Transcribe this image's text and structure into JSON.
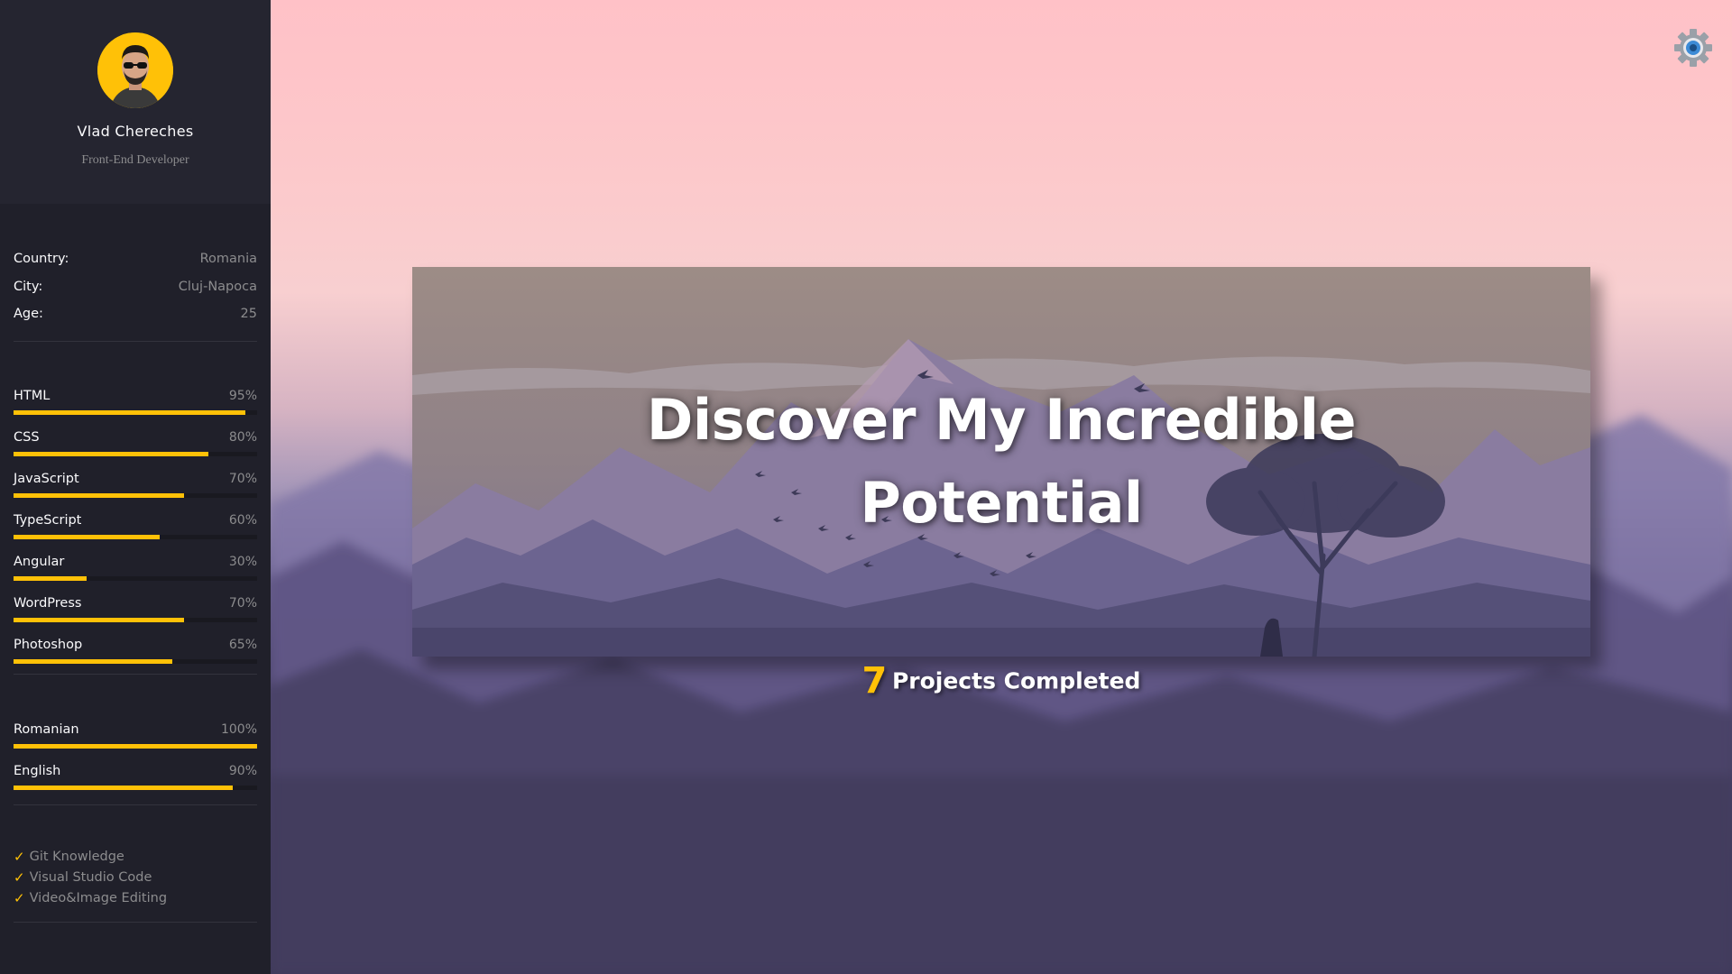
{
  "profile": {
    "name": "Vlad Chereches",
    "role": "Front-End Developer"
  },
  "info": [
    {
      "key": "Country:",
      "value": "Romania"
    },
    {
      "key": "City:",
      "value": "Cluj-Napoca"
    },
    {
      "key": "Age:",
      "value": "25"
    }
  ],
  "skills": [
    {
      "label": "HTML",
      "pct": "95%",
      "level": 0.95
    },
    {
      "label": "CSS",
      "pct": "80%",
      "level": 0.8
    },
    {
      "label": "JavaScript",
      "pct": "70%",
      "level": 0.7
    },
    {
      "label": "TypeScript",
      "pct": "60%",
      "level": 0.6
    },
    {
      "label": "Angular",
      "pct": "30%",
      "level": 0.3
    },
    {
      "label": "WordPress",
      "pct": "70%",
      "level": 0.7
    },
    {
      "label": "Photoshop",
      "pct": "65%",
      "level": 0.65
    }
  ],
  "languages": [
    {
      "label": "Romanian",
      "pct": "100%",
      "level": 1.0
    },
    {
      "label": "English",
      "pct": "90%",
      "level": 0.9
    }
  ],
  "tools": [
    "Git Knowledge",
    "Visual Studio Code",
    "Video&Image Editing"
  ],
  "hero": {
    "title_line1": "Discover My Incredible",
    "title_line2": "Potential"
  },
  "projects": {
    "count": "7",
    "label": "Projects Completed"
  },
  "colors": {
    "accent": "#ffc107",
    "sidebar": "#20202a",
    "settings": "#3d8bd6"
  },
  "icons": {
    "settings": "gear-icon",
    "check": "checkmark-icon"
  }
}
